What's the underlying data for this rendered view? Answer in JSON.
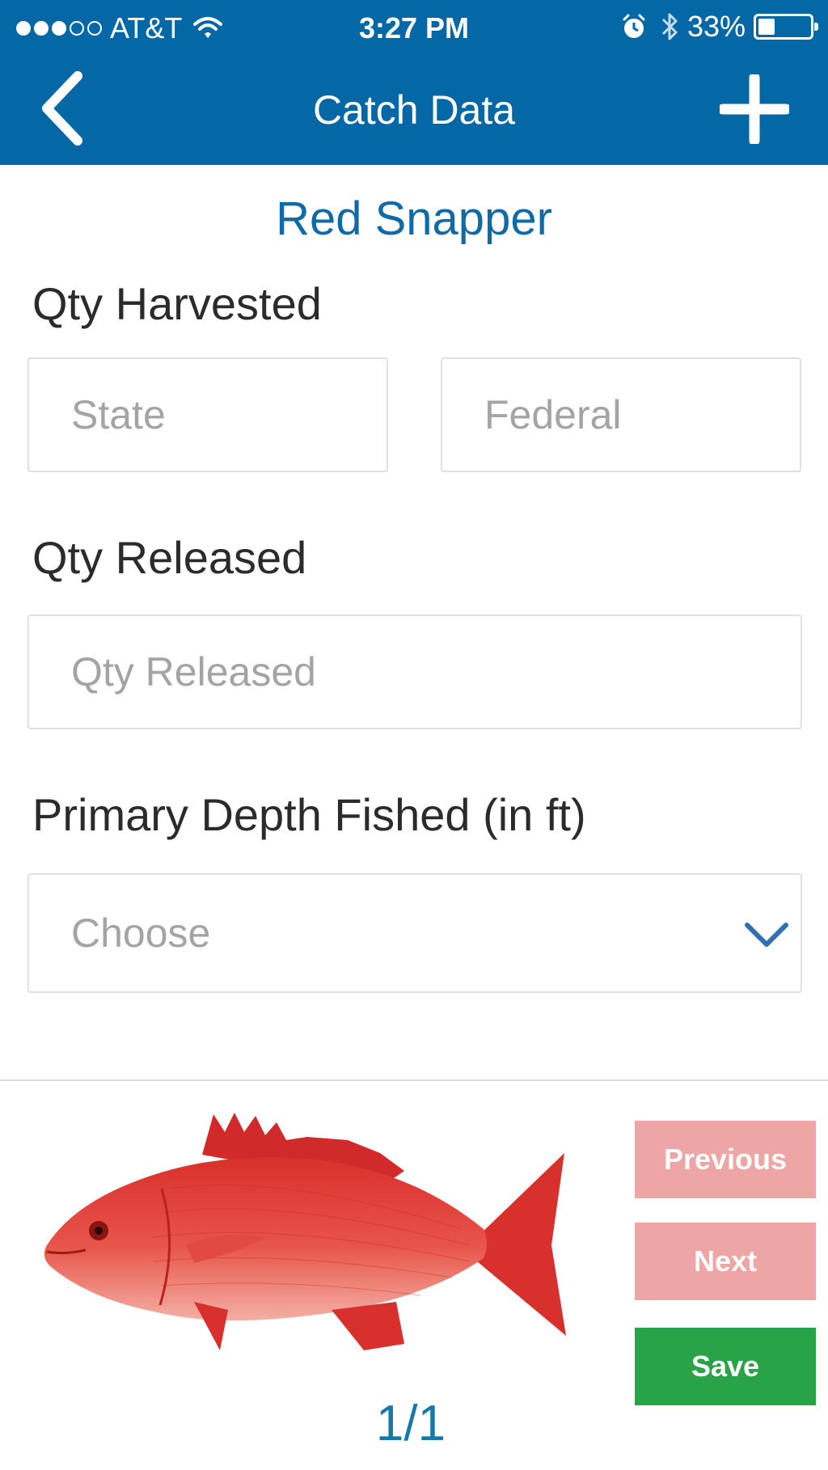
{
  "status_bar": {
    "carrier": "AT&T",
    "time": "3:27 PM",
    "battery_percent": "33%",
    "battery_level": 0.33,
    "signal_bars_filled": 3,
    "signal_bars_total": 5
  },
  "header": {
    "title": "Catch Data",
    "back_icon": "chevron-left-icon",
    "add_icon": "plus-icon",
    "background_color": "#0568a6"
  },
  "species": {
    "name": "Red Snapper"
  },
  "form": {
    "harvested": {
      "label": "Qty Harvested",
      "state_placeholder": "State",
      "federal_placeholder": "Federal"
    },
    "released": {
      "label": "Qty Released",
      "placeholder": "Qty Released"
    },
    "depth": {
      "label": "Primary Depth Fished (in ft)",
      "selected": "Choose"
    }
  },
  "pager": {
    "text": "1/1"
  },
  "buttons": {
    "previous": "Previous",
    "next": "Next",
    "save": "Save"
  },
  "colors": {
    "accent": "#0f6aa7",
    "disabled_button": "#eea5a5",
    "save_button": "#29a347"
  }
}
